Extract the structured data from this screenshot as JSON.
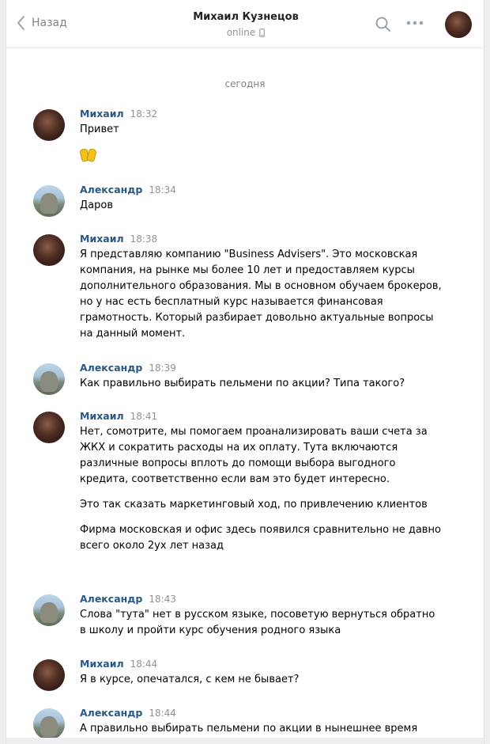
{
  "header": {
    "back_label": "Назад",
    "peer_name": "Михаил Кузнецов",
    "peer_status": "online"
  },
  "date_separator": "сегодня",
  "messages": [
    {
      "author": "Михаил",
      "time": "18:32",
      "avatar": "michael",
      "paragraphs": [
        "Привет"
      ],
      "emoji": "raised-hands"
    },
    {
      "author": "Александр",
      "time": "18:34",
      "avatar": "alexander",
      "paragraphs": [
        "Даров"
      ]
    },
    {
      "author": "Михаил",
      "time": "18:38",
      "avatar": "michael",
      "paragraphs": [
        "Я представляю компанию \"Business Advisers\". Это московская компания, на рынке мы более 10 лет и предоставляем курсы дополнительного образования. Мы в основном обучаем брокеров, но у нас есть бесплатный курс называется финансовая грамотность. Который разбирает довольно актуальные вопросы на данный момент."
      ]
    },
    {
      "author": "Александр",
      "time": "18:39",
      "avatar": "alexander",
      "paragraphs": [
        "Как правильно выбирать пельмени по акции? Типа такого?"
      ]
    },
    {
      "author": "Михаил",
      "time": "18:41",
      "avatar": "michael",
      "paragraphs": [
        "Нет, сомотрите, мы помогаем проанализировать ваши счета за ЖКХ и сократить расходы на их оплату. Тута включаются различные вопросы вплоть до помощи выбора выгодного кредита, соответственно если вам это будет интересно.",
        "Это так сказать маркетинговый ход, по привлечению клиентов",
        "Фирма московская и офис здесь появился сравнительно не давно всего около 2ух лет назад"
      ]
    },
    {
      "author": "Александр",
      "time": "18:43",
      "avatar": "alexander",
      "paragraphs": [
        "Слова \"тута\" нет в русском языке, посоветую вернуться обратно в школу и пройти курс обучения родного языка"
      ]
    },
    {
      "author": "Михаил",
      "time": "18:44",
      "avatar": "michael",
      "paragraphs": [
        "Я в курсе, опечатался, с кем не бывает?"
      ]
    },
    {
      "author": "Александр",
      "time": "18:44",
      "avatar": "alexander",
      "paragraphs": [
        "А правильно выбирать пельмени по акции в нынешнее время"
      ]
    }
  ],
  "colors": {
    "author_link": "#2a5885",
    "muted": "#939393",
    "background": "#edeef0"
  }
}
